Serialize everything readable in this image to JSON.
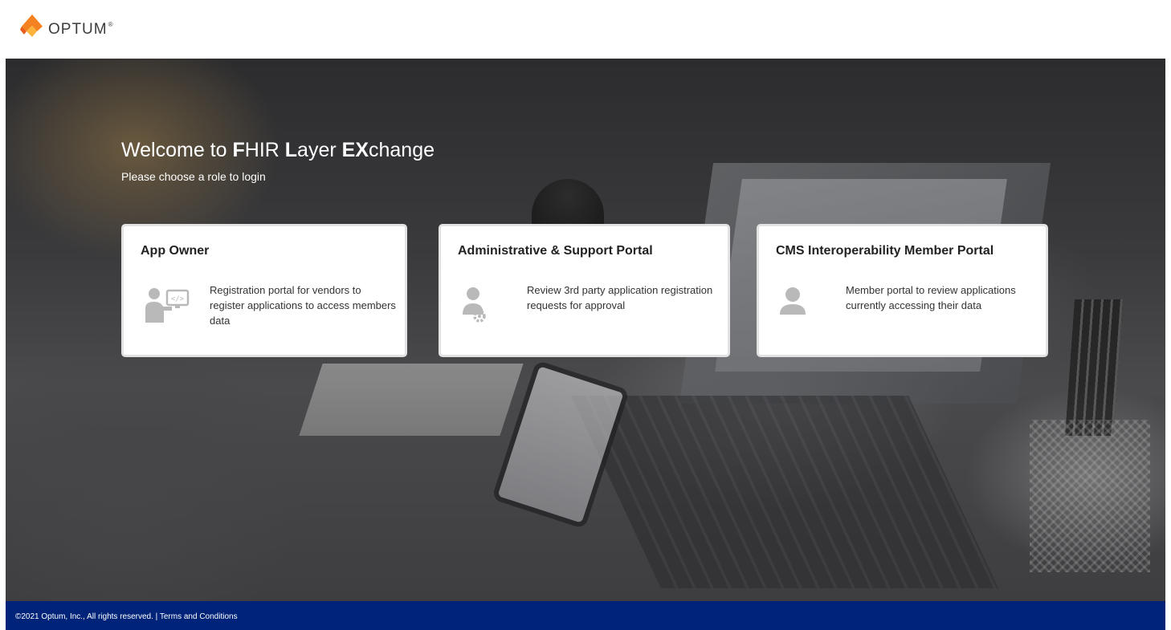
{
  "header": {
    "logo_text": "OPTUM",
    "logo_mark": "®",
    "logo_icon": "optum-logo-icon"
  },
  "hero": {
    "title_parts": [
      {
        "text": "Welcome to ",
        "bold": false
      },
      {
        "text": "F",
        "bold": true
      },
      {
        "text": "HIR ",
        "bold": false
      },
      {
        "text": "L",
        "bold": true
      },
      {
        "text": "ayer ",
        "bold": false
      },
      {
        "text": "EX",
        "bold": true
      },
      {
        "text": "change",
        "bold": false
      }
    ],
    "subtitle": "Please choose a role to login"
  },
  "cards": [
    {
      "title": "App Owner",
      "icon": "developer-screen-icon",
      "description": "Registration portal for vendors to register applications to access members data"
    },
    {
      "title": "Administrative & Support Portal",
      "icon": "admin-user-gear-icon",
      "description": "Review 3rd party application registration requests for approval"
    },
    {
      "title": "CMS Interoperability Member Portal",
      "icon": "member-user-icon",
      "description": "Member portal to review applications currently accessing their data"
    }
  ],
  "footer": {
    "copyright": "©2021 Optum, Inc., All rights reserved. | ",
    "terms_link": "Terms and Conditions"
  },
  "colors": {
    "footer_bg": "#00237a",
    "logo_orange": "#f58220",
    "logo_yellow": "#fbb33b",
    "icon_gray": "#b9b9b9"
  }
}
